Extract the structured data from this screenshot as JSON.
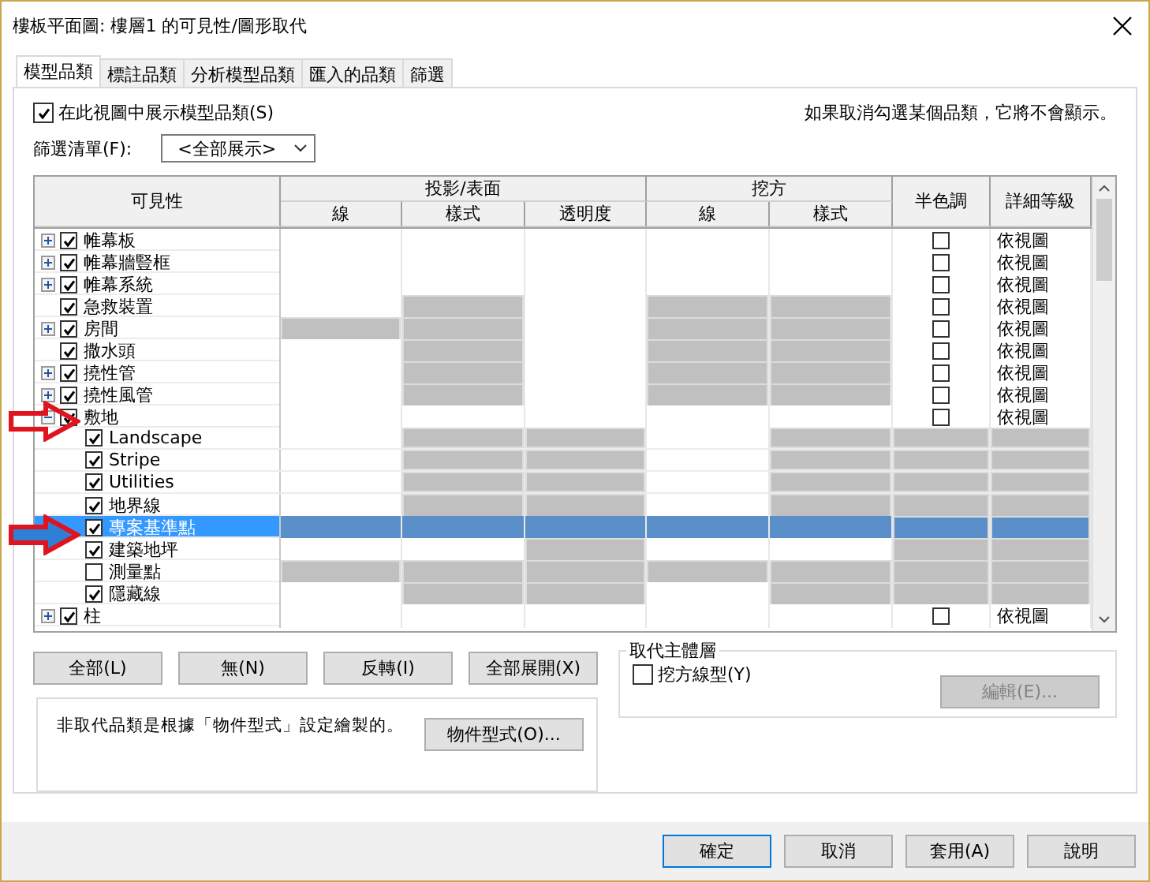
{
  "window": {
    "title": "樓板平面圖: 樓層1 的可見性/圖形取代"
  },
  "tabs": [
    {
      "label": "模型品類",
      "selected": true
    },
    {
      "label": "標註品類",
      "selected": false
    },
    {
      "label": "分析模型品類",
      "selected": false
    },
    {
      "label": "匯入的品類",
      "selected": false
    },
    {
      "label": "篩選",
      "selected": false
    }
  ],
  "show_categories": {
    "label": "在此視圖中展示模型品類(S)",
    "checked": true
  },
  "note": "如果取消勾選某個品類，它將不會顯示。",
  "filter": {
    "label": "篩選清單(F):",
    "value": "<全部展示>"
  },
  "table": {
    "visibility": "可見性",
    "projection": "投影/表面",
    "projection_columns": [
      "線",
      "樣式",
      "透明度"
    ],
    "cut": "挖方",
    "cut_columns": [
      "線",
      "樣式"
    ],
    "halftone": "半色調",
    "detail": "詳細等級",
    "rows": [
      {
        "name": "帷幕板",
        "checked": true,
        "expanded": false,
        "selected": false,
        "grey": [
          false,
          false,
          false,
          false,
          false
        ],
        "halftone": false,
        "detail": "依視圖"
      },
      {
        "name": "帷幕牆豎框",
        "checked": true,
        "expanded": false,
        "selected": false,
        "grey": [
          false,
          false,
          false,
          false,
          false
        ],
        "halftone": false,
        "detail": "依視圖"
      },
      {
        "name": "帷幕系統",
        "checked": true,
        "expanded": false,
        "selected": false,
        "grey": [
          false,
          false,
          false,
          false,
          false
        ],
        "halftone": false,
        "detail": "依視圖"
      },
      {
        "name": "急救裝置",
        "checked": true,
        "selected": false,
        "grey": [
          false,
          true,
          false,
          true,
          true
        ],
        "halftone": false,
        "detail": "依視圖"
      },
      {
        "name": "房間",
        "checked": true,
        "expanded": false,
        "selected": false,
        "grey": [
          true,
          true,
          false,
          true,
          true
        ],
        "halftone": false,
        "detail": "依視圖"
      },
      {
        "name": "撒水頭",
        "checked": true,
        "selected": false,
        "grey": [
          false,
          true,
          false,
          true,
          true
        ],
        "halftone": false,
        "detail": "依視圖"
      },
      {
        "name": "撓性管",
        "checked": true,
        "expanded": false,
        "selected": false,
        "grey": [
          false,
          true,
          false,
          true,
          true
        ],
        "halftone": false,
        "detail": "依視圖"
      },
      {
        "name": "撓性風管",
        "checked": true,
        "expanded": false,
        "selected": false,
        "grey": [
          false,
          true,
          false,
          true,
          true
        ],
        "halftone": false,
        "detail": "依視圖"
      },
      {
        "name": "敷地",
        "checked": true,
        "expanded": true,
        "selected": false,
        "grey": [
          false,
          false,
          false,
          false,
          false
        ],
        "halftone": false,
        "detail": "依視圖",
        "children": [
          {
            "name": "Landscape",
            "checked": true,
            "selected": false,
            "grey": [
              false,
              true,
              true,
              false,
              true
            ]
          },
          {
            "name": "Stripe",
            "checked": true,
            "selected": false,
            "grey": [
              false,
              true,
              true,
              false,
              true
            ]
          },
          {
            "name": "Utilities",
            "checked": true,
            "selected": false,
            "grey": [
              false,
              true,
              true,
              false,
              true
            ]
          },
          {
            "name": "地界線",
            "checked": true,
            "selected": false,
            "grey": [
              false,
              true,
              true,
              false,
              true
            ]
          },
          {
            "name": "專案基準點",
            "checked": true,
            "selected": true,
            "grey": [
              false,
              false,
              false,
              false,
              false
            ]
          },
          {
            "name": "建築地坪",
            "checked": true,
            "selected": false,
            "grey": [
              false,
              false,
              true,
              false,
              false
            ]
          },
          {
            "name": "測量點",
            "checked": false,
            "selected": false,
            "grey": [
              true,
              true,
              true,
              true,
              true
            ]
          },
          {
            "name": "隱藏線",
            "checked": true,
            "selected": false,
            "grey": [
              false,
              true,
              true,
              false,
              true
            ]
          }
        ]
      },
      {
        "name": "柱",
        "checked": true,
        "expanded": false,
        "selected": false,
        "grey": [
          false,
          false,
          false,
          false,
          false
        ],
        "halftone": false,
        "detail": "依視圖"
      }
    ]
  },
  "table_buttons": [
    "全部(L)",
    "無(N)",
    "反轉(I)",
    "全部展開(X)"
  ],
  "override_note": "非取代品類是根據「物件型式」設定繪製的。",
  "object_styles_button": "物件型式(O)...",
  "host_layers": {
    "title": "取代主體層",
    "checkbox": {
      "label": "挖方線型(Y)",
      "checked": false
    },
    "edit_button": {
      "label": "編輯(E)...",
      "disabled": true
    }
  },
  "footer_buttons": [
    {
      "label": "確定",
      "default": true
    },
    {
      "label": "取消",
      "default": false
    },
    {
      "label": "套用(A)",
      "default": false
    },
    {
      "label": "說明",
      "default": false
    }
  ]
}
